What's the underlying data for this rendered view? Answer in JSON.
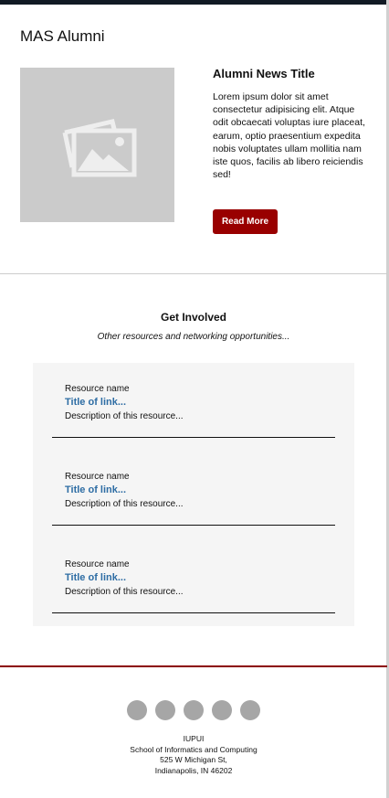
{
  "header": {
    "title": "MAS Alumni"
  },
  "news": {
    "image_icon": "image-placeholder-icon",
    "title": "Alumni News Title",
    "body": "Lorem ipsum dolor sit amet consectetur adipisicing elit. Atque odit obcaecati voluptas iure placeat, earum, optio praesentium expedita nobis voluptates ullam mollitia nam iste quos, facilis ab libero reiciendis sed!",
    "button": "Read More",
    "button_color": "#990000"
  },
  "get_involved": {
    "title": "Get Involved",
    "subtitle": "Other resources and networking opportunities...",
    "resources": [
      {
        "name": "Resource name",
        "link": "Title of link...",
        "description": "Description of this resource..."
      },
      {
        "name": "Resource name",
        "link": "Title of link...",
        "description": "Description of this resource..."
      },
      {
        "name": "Resource name",
        "link": "Title of link...",
        "description": "Description of this resource..."
      }
    ]
  },
  "footer": {
    "social_icons": [
      "social-icon",
      "social-icon",
      "social-icon",
      "social-icon",
      "social-icon"
    ],
    "lines": [
      "IUPUI",
      "School of Informatics and Computing",
      "525 W Michigan St,",
      "Indianapolis, IN 46202"
    ]
  }
}
